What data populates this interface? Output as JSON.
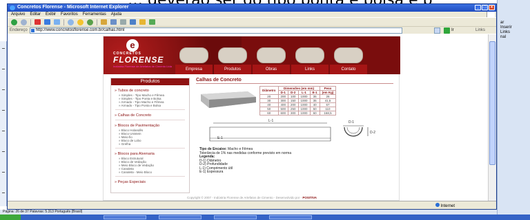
{
  "doc_heading": "… deverão ser do tipo ponta e bolsa e p",
  "word_side": {
    "items": [
      "ar",
      "Inserir",
      "Links",
      "nal"
    ]
  },
  "ie": {
    "title": "Concretos Florense - Microsoft Internet Explorer",
    "menu": [
      "Arquivo",
      "Editar",
      "Exibir",
      "Favoritos",
      "Ferramentas",
      "Ajuda"
    ],
    "address_label": "Endereço",
    "url": "http://www.concretosflorense.com.br/calhas.html",
    "go_label": "Ir",
    "links_label": "Links",
    "status_zone": "Internet"
  },
  "site": {
    "logo_top": "CONCRETOS",
    "logo_name": "FLORENSE",
    "logo_tagline": "Indústria Florense de Artefatos de Cimento Ltda",
    "nav": [
      "Empresa",
      "Produtos",
      "Obras",
      "Links",
      "Contato"
    ],
    "sidebar": {
      "header": "Produtos",
      "sections": [
        {
          "title": "Tubos de concreto",
          "items": [
            "Simples - Tipo Macho e Fêmea",
            "Simples - Tipo Ponta e Bolsa",
            "Armado - Tipo Macho e Fêmea",
            "Armado - Tipo Ponta e Bolsa"
          ]
        },
        {
          "title": "Calhas de Concreto",
          "items": []
        },
        {
          "title": "Blocos de Pavimentação",
          "items": [
            "Bloco Holandês",
            "Bloco Unistein",
            "Meio-fio",
            "Bloco de Lobo",
            "Grelha"
          ]
        },
        {
          "title": "Blocos para Alvenaria",
          "items": [
            "Bloco Estrutural",
            "Bloco de Vedação",
            "Meio Bloco de Vedação",
            "Canaleta",
            "Canaleta - Meio Bloco"
          ]
        },
        {
          "title": "Peças Especiais",
          "items": []
        }
      ]
    },
    "main": {
      "title": "Calhas de Concreto",
      "table": {
        "col_diam": "Diâmetro",
        "col_dims": "Dimensões (em mm)",
        "col_weight": "Peso",
        "col_weight_unit": "(em Kg)",
        "subcols": [
          "D-1",
          "D-2",
          "L-1",
          "E-1"
        ],
        "rows": [
          [
            "20",
            "200",
            "100",
            "1000",
            "35",
            "26"
          ],
          [
            "30",
            "300",
            "150",
            "1000",
            "35",
            "41,5"
          ],
          [
            "40",
            "400",
            "200",
            "1000",
            "40",
            "67"
          ],
          [
            "50",
            "500",
            "250",
            "1000",
            "50",
            "110"
          ],
          [
            "60",
            "600",
            "300",
            "1000",
            "60",
            "168,5"
          ]
        ]
      },
      "diagram_labels": {
        "l1": "L-1",
        "e1": "E-1",
        "d1": "D-1",
        "d2": "D-2"
      },
      "notes": [
        {
          "bold": "Tipo de Encaixe:",
          "text": " Macho e Fêmea"
        },
        {
          "bold": "",
          "text": "Tolerância de 1% nas medidas conforme previsto em norma"
        },
        {
          "bold": "Legenda:",
          "text": ""
        },
        {
          "bold": "",
          "text": "D-1) Diâmetro"
        },
        {
          "bold": "",
          "text": "D-2) Profundidade"
        },
        {
          "bold": "",
          "text": "L-1) Comprimento útil"
        },
        {
          "bold": "",
          "text": "E-1) Espessura"
        }
      ]
    },
    "footer": "Copyright © 2007 - Indústria Florense de Artefatos de Cimento - Desenvolvido por - ",
    "footer_brand": "POSITIVA"
  },
  "word_status": "Página: 26 de 37    Palavras: 5.313    Português (Brasil)"
}
